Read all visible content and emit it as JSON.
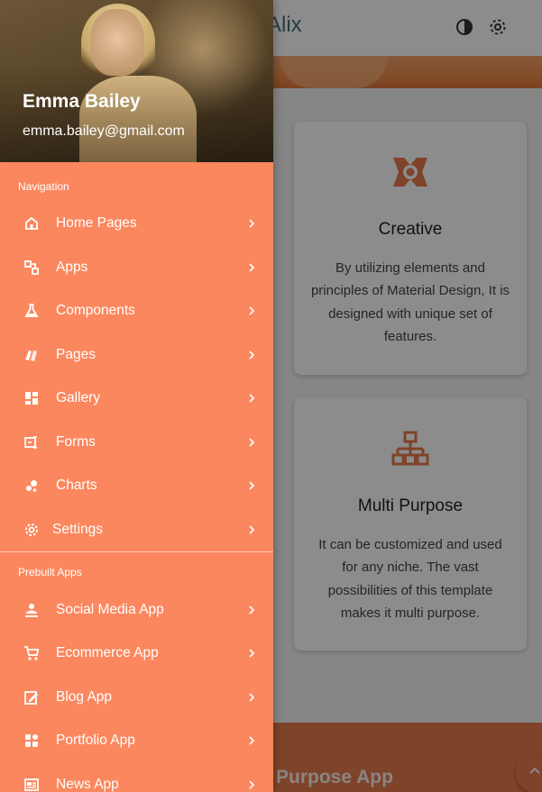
{
  "app": {
    "brand_fragment": "Alix",
    "icons": [
      "contrast-icon",
      "settings-gear-icon"
    ]
  },
  "cards": [
    {
      "icon": "creative-icon",
      "title": "Creative",
      "text": "By utilizing elements and principles of Material Design, It is designed with unique set of features."
    },
    {
      "icon": "network-sitemap-icon",
      "title": "Multi Purpose",
      "text": "It can be customized and used for any niche. The vast possibilities of this template makes it multi purpose."
    }
  ],
  "footer": {
    "title_fragment": "Purpose App",
    "scroll_top_icon": "chevron-up-icon"
  },
  "drawer": {
    "profile": {
      "name": "Emma Bailey",
      "email": "emma.bailey@gmail.com"
    },
    "navigation_label": "Navigation",
    "navigation": [
      {
        "label": "Home Pages",
        "icon": "home-icon"
      },
      {
        "label": "Apps",
        "icon": "apps-icon"
      },
      {
        "label": "Components",
        "icon": "flask-icon"
      },
      {
        "label": "Pages",
        "icon": "pages-icon"
      },
      {
        "label": "Gallery",
        "icon": "gallery-icon"
      },
      {
        "label": "Forms",
        "icon": "forms-icon"
      },
      {
        "label": "Charts",
        "icon": "charts-icon"
      },
      {
        "label": "Settings",
        "icon": "settings-icon"
      }
    ],
    "prebuilt_label": "Prebuilt Apps",
    "prebuilt": [
      {
        "label": "Social Media App",
        "icon": "person-icon"
      },
      {
        "label": "Ecommerce App",
        "icon": "cart-icon"
      },
      {
        "label": "Blog App",
        "icon": "edit-icon"
      },
      {
        "label": "Portfolio App",
        "icon": "portfolio-icon"
      },
      {
        "label": "News App",
        "icon": "news-icon"
      }
    ]
  },
  "colors": {
    "drawer_bg": "#fb875e",
    "accent": "#e87a4d",
    "text_on_accent": "#ffffff"
  }
}
